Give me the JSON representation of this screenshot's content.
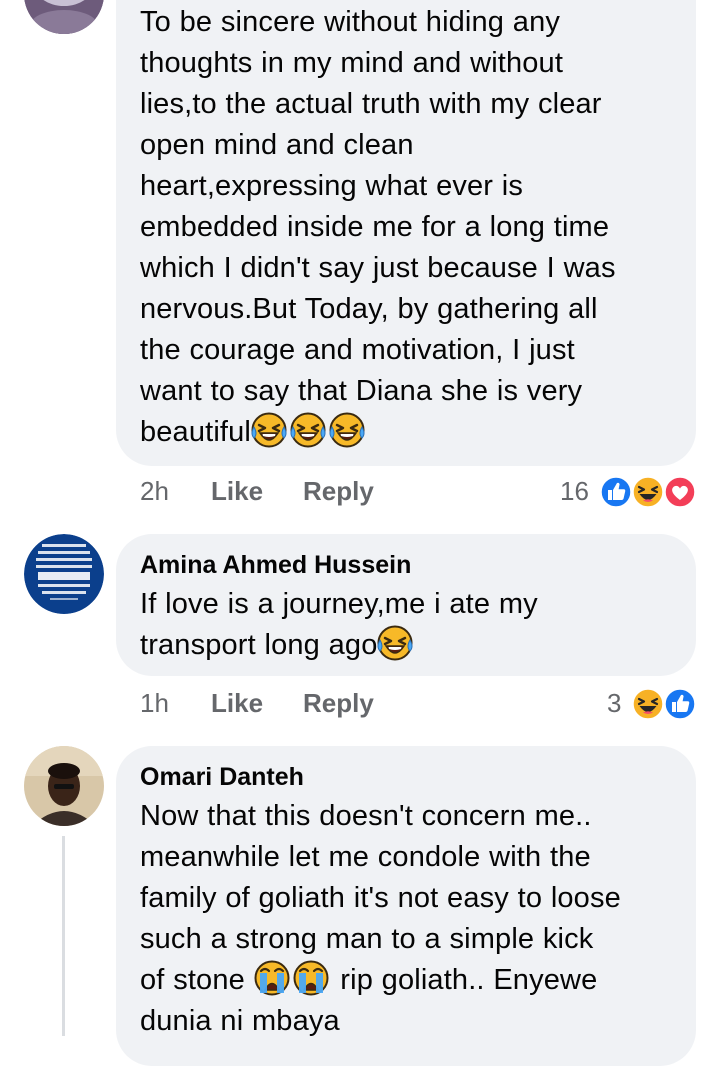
{
  "comments": [
    {
      "text_parts": [
        "To be sincere without hiding any\nthoughts in my mind and without\nlies,to the actual truth with my clear\nopen mind and clean\nheart,expressing what ever is\nembedded inside me for a long time\nwhich I didn't say just because I was\nnervous.But Today, by gathering all\nthe courage and motivation, I just\nwant to say that Diana she is very\nbeautiful"
      ],
      "emojis": [
        "laughing-tears-icon",
        "laughing-tears-icon",
        "laughing-tears-icon"
      ],
      "time": "2h",
      "like_label": "Like",
      "reply_label": "Reply",
      "reaction_count": "16",
      "reactions": [
        "like-reaction-icon",
        "haha-reaction-icon",
        "love-reaction-icon"
      ]
    },
    {
      "author": "Amina Ahmed Hussein",
      "text": "If love is a journey,me i ate my\ntransport long ago",
      "emojis": [
        "laughing-tears-icon"
      ],
      "time": "1h",
      "like_label": "Like",
      "reply_label": "Reply",
      "reaction_count": "3",
      "reactions": [
        "haha-reaction-icon",
        "like-reaction-icon"
      ]
    },
    {
      "author": "Omari Danteh",
      "text_before": "Now that this doesn't concern me..\nmeanwhile let me condole with the\nfamily of goliath it's not easy to loose\nsuch a strong man to a simple kick\nof stone ",
      "emojis": [
        "crying-face-icon",
        "crying-face-icon"
      ],
      "text_after": " rip goliath.. Enyewe\ndunia ni mbaya"
    }
  ],
  "colors": {
    "bubble": "#f0f2f5",
    "meta": "#65676b",
    "like_blue": "#1877f2",
    "love_red": "#f33e58",
    "haha_yellow": "#f7b125"
  }
}
